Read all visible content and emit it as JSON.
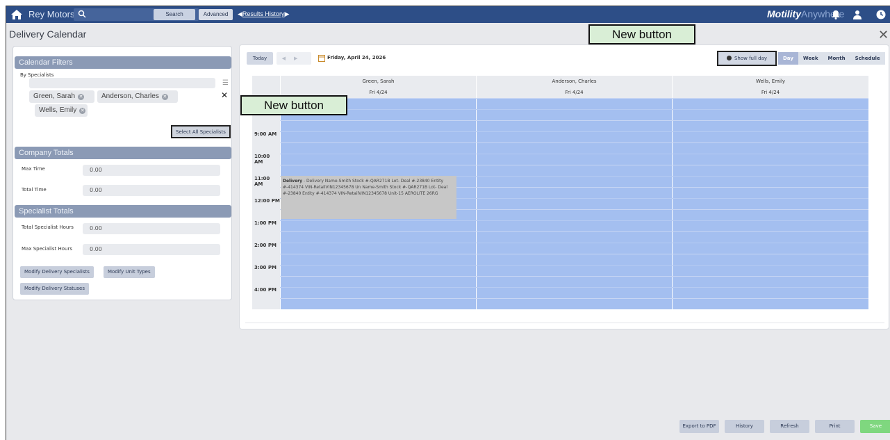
{
  "topbar": {
    "brand": "Rey Motors",
    "search_label": "Search",
    "advanced_label": "Advanced",
    "results_history": "Results History",
    "product_name_bold": "Motility",
    "product_name_light": "Anywhere"
  },
  "page": {
    "title": "Delivery Calendar"
  },
  "filters": {
    "header": "Calendar Filters",
    "by_specialists_label": "By Specialists",
    "chips": [
      "Green, Sarah",
      "Anderson, Charles",
      "Wells, Emily"
    ],
    "select_all_label": "Select All Specialists"
  },
  "company_totals": {
    "header": "Company Totals",
    "max_time_label": "Max Time",
    "max_time_value": "0.00",
    "total_time_label": "Total Time",
    "total_time_value": "0.00"
  },
  "specialist_totals": {
    "header": "Specialist Totals",
    "total_hours_label": "Total Specialist Hours",
    "total_hours_value": "0.00",
    "max_hours_label": "Max Specialist Hours",
    "max_hours_value": "0.00"
  },
  "modify_buttons": {
    "specialists": "Modify Delivery Specialists",
    "unit_types": "Modify Unit Types",
    "statuses": "Modify Delivery Statuses"
  },
  "calendar": {
    "today_label": "Today",
    "date_label": "Friday, April 24, 2026",
    "show_full_day": "Show full day",
    "views": [
      "Day",
      "Week",
      "Month",
      "Schedule"
    ],
    "active_view": "Day",
    "columns": [
      {
        "name": "Green, Sarah",
        "date": "Fri 4/24"
      },
      {
        "name": "Anderson, Charles",
        "date": "Fri 4/24"
      },
      {
        "name": "Wells, Emily",
        "date": "Fri 4/24"
      }
    ],
    "times": [
      "9:00 AM",
      "10:00 AM",
      "11:00 AM",
      "12:00 PM",
      "1:00 PM",
      "2:00 PM",
      "3:00 PM",
      "4:00 PM"
    ],
    "event": {
      "title": "Delivery",
      "text": " - Delivery Name-Smith Stock #-QAR271B Lot- Deal #-23840 Entity #-414374 VIN-RetailVIN12345678 Un Name-Smith Stock #-QAR271B Lot- Deal #-23840 Entity #-414374 VIN-RetailVIN12345678 Unit-15 AEROLITE 26RG"
    }
  },
  "footer": {
    "export_pdf": "Export to PDF",
    "history": "History",
    "refresh": "Refresh",
    "print": "Print",
    "save": "Save"
  },
  "callouts": {
    "top": "New button",
    "left": "New button"
  },
  "colors": {
    "topbar": "#2d4e87",
    "calendar_slot": "#a4bff0",
    "save": "#7fd77f",
    "callout": "#d9eed6"
  }
}
